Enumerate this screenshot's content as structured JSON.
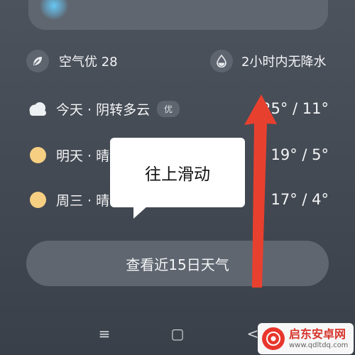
{
  "air": {
    "label": "空气优 28",
    "icon": "leaf-icon"
  },
  "rain": {
    "label": "2小时内无降水",
    "icon": "raindrop-icon"
  },
  "forecast": [
    {
      "day_label": "今天 · 阴转多云",
      "badge": "优",
      "temps": "25° / 11°",
      "icon": "cloud-icon"
    },
    {
      "day_label": "明天 · 晴",
      "temps": "19° / 5°",
      "icon": "sun-icon"
    },
    {
      "day_label": "周三 · 晴",
      "temps": "17° / 4°",
      "icon": "sun-icon"
    }
  ],
  "button_15day": "查看近15日天气",
  "tooltip": "往上滑动",
  "arrow_color": "#e8402f",
  "nav": {
    "menu": "≡",
    "home": "▢",
    "back": "<"
  },
  "watermark": {
    "title": "启东安卓网",
    "url": "www.qdltdq.com"
  }
}
